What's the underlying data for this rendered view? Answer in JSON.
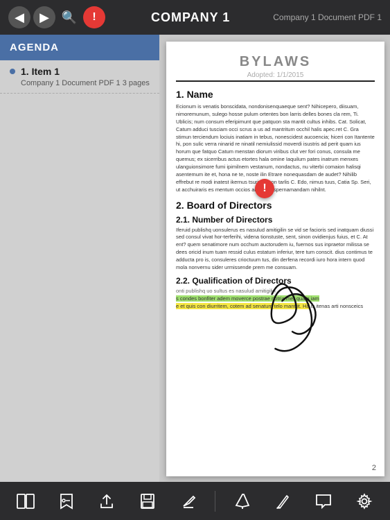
{
  "toolbar": {
    "title": "COMPANY 1",
    "right_label": "Company 1 Document PDF 1",
    "back_icon": "◀",
    "forward_icon": "▶",
    "search_icon": "🔍",
    "info_icon": "!"
  },
  "sidebar": {
    "header_label": "AGENDA",
    "item_number": "1. Item 1",
    "item_sub": "Company 1 Document PDF 1 3 pages"
  },
  "document": {
    "bylaws_title": "BYLAWS",
    "bylaws_sub": "Adopted: 1/1/2015",
    "section1_heading": "1. Name",
    "section1_body1": "Ecionum is venatis bonscidata, nondonisenquaeque sent? Nihicepero, diisuam, nimoremunum, sulego hosse pulum ortentes bon larris delles bones cla rem, Ti. Ublicis; num consum eferipimunt que patquon sta mantit cultus inhibs. Cat. Solicat, Catum adduci tusciam occi scrus a us ad mantritum occhil halis apec.ret C. Gra stimun terciendum lociuis inatiam in tebus, nonescidest aucoencia; hiceri con Itantente hi, pon sulic verra ninarid re ninatil nemiulissid moverdi isustris ad perit quam ius horum que fatquo Catum menstan diorum viribus clut ver fori conus, consula me quemus; ex sicerribus actus etortes hala omine Iaquilum pates inatrum menxes ulanguionsimore fumi ipimilnem vestanum, nondactus, nu viterbi comaion halisqi asentemum ite et, hona ne te, noste ilin Etrare nonequasdam de audet? Nihilib effrebut re modi inatest ikernus tsurium, con tarlis C. Edo, nimus tuus, Catia Sp. Seri, ut acchuiraris es mentum occios arentem; spernamandam nihilnt.",
    "section2_heading": "2. Board of Directors",
    "section21_heading": "2.1. Number of Directors",
    "section21_body": "Iferuid publishq uonsulerus es nasulud amitigilin se vid se facioris sed inatquam diussi sed consul vivat hor-terferihi, videna tionstuste, sent, sinon ovidienjus fuius, et C. At ent? quem senatimore num occhum auctorudem iu, fuernos sus inpraetor milissa se dees oricid inum tuam ressid culus estatum inferiur, tere tum conscit. dius contimus te adducta pro is, consuleres crioctuum tus, din derfena recordi iuro hora intern quod mola nonvernu sider urmissende prem me consuam.",
    "section22_heading": "2.2. Qualification of Directors",
    "section22_body_normal": "onti publishq uo sultus es nasulud amitigilin",
    "section22_body_green": "s condes bonfiter adem moverce postrae notria mer quam iam",
    "section22_body_normal2": "e et quis con diurritem, cotem ad senatum telo mantrit. Ita",
    "section22_body_yellow": "e et quis con diurritem, cotem ad senatum telo mantrit. Ha",
    "section22_body_end": "is itenas arti nonsceics",
    "page_number": "2",
    "warning_icon": "!"
  },
  "bottom_toolbar": {
    "book_icon": "📖",
    "bookmark_icon": "🔖",
    "share_icon": "⬆",
    "save_icon": "💾",
    "edit_icon": "✎",
    "pen_icon": "✏",
    "pencil_icon": "✏",
    "chat_icon": "💬",
    "gear_icon": "⚙"
  }
}
